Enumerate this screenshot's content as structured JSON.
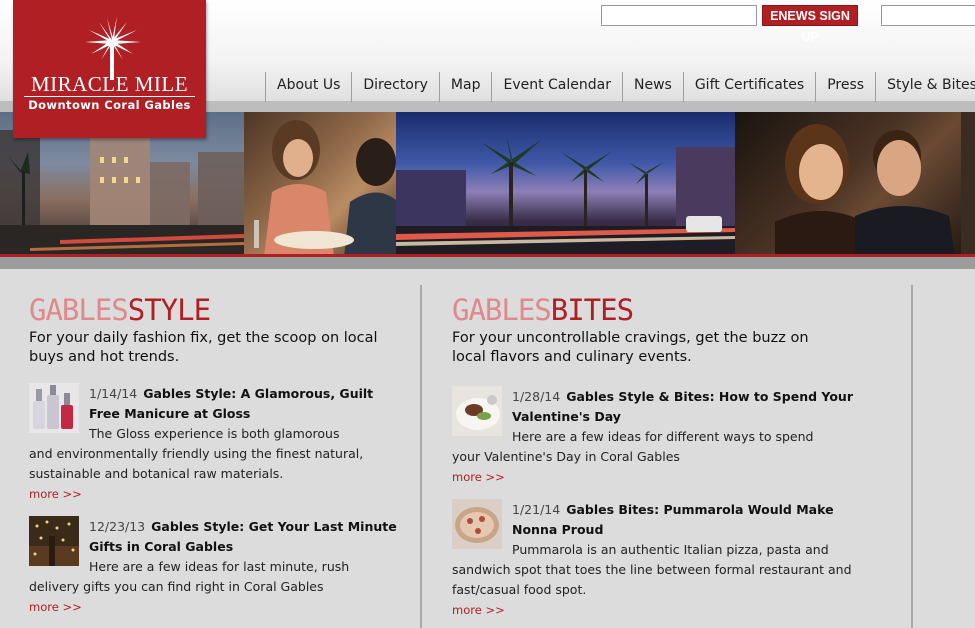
{
  "logo": {
    "title": "MIRACLE MILE",
    "subtitle": "Downtown Coral Gables",
    "brand_color": "#b01f24"
  },
  "header": {
    "enews_email_value": "",
    "enews_button": "ENEWS SIGN UP",
    "search_value": ""
  },
  "nav": [
    {
      "label": "About Us"
    },
    {
      "label": "Directory"
    },
    {
      "label": "Map"
    },
    {
      "label": "Event Calendar"
    },
    {
      "label": "News"
    },
    {
      "label": "Gift Certificates"
    },
    {
      "label": "Press"
    },
    {
      "label": "Style & Bites"
    }
  ],
  "hero": {
    "photos": [
      {
        "icon": "street-dusk-photo"
      },
      {
        "icon": "dining-couple-photo"
      },
      {
        "icon": "palm-street-night-photo"
      },
      {
        "icon": "smiling-couple-photo"
      }
    ]
  },
  "style": {
    "heading_light": "GABLES",
    "heading_dark": "STYLE",
    "intro": "For your daily fashion fix, get the scoop on local buys and hot trends.",
    "posts": [
      {
        "date": "1/14/14",
        "title": "Gables Style: A Glamorous, Guilt Free Manicure at Gloss",
        "excerpt": "The Gloss experience is both glamorous and environmentally friendly using the finest natural, sustainable and botanical raw materials.",
        "more": "more >>",
        "thumb": "nail-polish-thumbnail"
      },
      {
        "date": "12/23/13",
        "title": "Gables Style: Get Your Last Minute Gifts in Coral Gables",
        "excerpt": "Here are a few ideas for last minute, rush delivery gifts you can find right in Coral Gables",
        "more": "more >>",
        "thumb": "holiday-lights-thumbnail"
      }
    ]
  },
  "bites": {
    "heading_light": "GABLES",
    "heading_dark": "BITES",
    "intro": "For your uncontrollable cravings, get the buzz on local flavors and culinary events.",
    "posts": [
      {
        "date": "1/28/14",
        "title": "Gables Style & Bites: How to Spend Your Valentine's Day",
        "excerpt": "Here are a few ideas for different ways to spend your Valentine's Day in Coral Gables",
        "more": "more >>",
        "thumb": "plated-dish-thumbnail"
      },
      {
        "date": "1/21/14",
        "title": "Gables Bites: Pummarola Would Make Nonna Proud",
        "excerpt": "Pummarola is an authentic Italian pizza, pasta and sandwich spot that toes the line between formal restaurant and fast/casual food spot.",
        "more": "more >>",
        "thumb": "pizza-thumbnail"
      }
    ]
  }
}
